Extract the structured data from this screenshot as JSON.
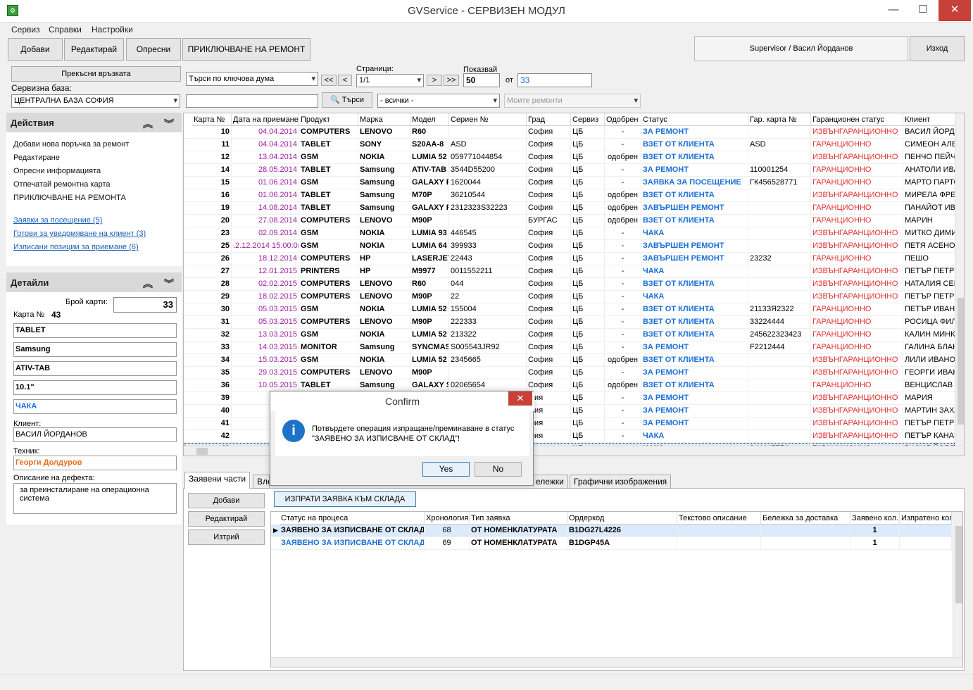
{
  "window": {
    "title": "GVService - СЕРВИЗЕН МОДУЛ",
    "icon": "app-icon",
    "min": "—",
    "max": "☐",
    "close": "✕"
  },
  "menu": [
    "Сервиз",
    "Справки",
    "Настройки"
  ],
  "toolbar": {
    "add": "Добави",
    "edit": "Редактирай",
    "refresh": "Опресни",
    "finish": "ПРИКЛЮЧВАНЕ НА РЕМОНТ",
    "user": "Supervisor / Васил Йорданов",
    "exit": "Изход"
  },
  "conn": {
    "disconnect": "Прекъсни връзката",
    "db_label": "Сервизна база:",
    "db_value": "ЦЕНТРАЛНА БАЗА СОФИЯ"
  },
  "search": {
    "mode": "Търси по ключова дума",
    "query": "",
    "button": "Търси",
    "filter": "- всички -",
    "my_repairs": "Моите ремонти"
  },
  "paging": {
    "label": "Страници:",
    "page": "1/1",
    "first": "<<",
    "prev": "<",
    "next": ">",
    "last": ">>",
    "show_label": "Показвай",
    "show_value": "50",
    "of_label": "от",
    "total": "33"
  },
  "actions": {
    "title": "Действия",
    "items": [
      "Добави нова поръчка за ремонт",
      "Редактиране",
      "Опресни информацията",
      "Отпечатай ремонтна карта",
      "ПРИКЛЮЧВАНЕ НА РЕМОНТА"
    ],
    "links": [
      "Заявки за посещение (5)",
      "Готови за уведомяване на клиент (3)",
      "Изписани позиции за приемане (6)"
    ]
  },
  "details": {
    "title": "Детайли",
    "count_label": "Брой карти:",
    "count": "33",
    "card_label": "Карта №",
    "card": "43",
    "product": "TABLET",
    "brand": "Samsung",
    "model": "ATIV-TAB",
    "size": "10.1\"",
    "status": "ЧАКА",
    "client_label": "Клиент:",
    "client": "ВАСИЛ ЙОРДАНОВ",
    "tech_label": "Техник:",
    "tech": "Георги Долдуров",
    "defect_label": "Описание на дефекта:",
    "defect": "за преинсталиране на операционна система"
  },
  "grid": {
    "columns": [
      "Карта №",
      "Дата на приемане",
      "Продукт",
      "Марка",
      "Модел",
      "Сериен №",
      "Град",
      "Сервиз",
      "Одобрен",
      "Статус",
      "Гар. карта №",
      "Гаранционен статус",
      "Клиент"
    ],
    "rows": [
      [
        "10",
        "04.04.2014",
        "COMPUTERS",
        "LENOVO",
        "R60",
        "",
        "София",
        "ЦБ",
        "-",
        "ЗА РЕМОНТ",
        "",
        "ИЗВЪНГАРАНЦИОННО",
        "ВАСИЛ ЙОРДА"
      ],
      [
        "11",
        "04.04.2014",
        "TABLET",
        "SONY",
        "S20AA-8",
        "ASD",
        "София",
        "ЦБ",
        "-",
        "ВЗЕТ ОТ КЛИЕНТА",
        "ASD",
        "ГАРАНЦИОННО",
        "СИМЕОН АЛЕК"
      ],
      [
        "12",
        "13.04.2014",
        "GSM",
        "NOKIA",
        "LUMIA 52",
        "059771044854",
        "София",
        "ЦБ",
        "одобрен",
        "ВЗЕТ ОТ КЛИЕНТА",
        "",
        "ИЗВЪНГАРАНЦИОННО",
        "ПЕНЧО ПЕЙЧЕ"
      ],
      [
        "14",
        "28.05.2014",
        "TABLET",
        "Samsung",
        "ATIV-TAB",
        "3544D55200",
        "София",
        "ЦБ",
        "-",
        "ЗА РЕМОНТ",
        "110001254",
        "ГАРАНЦИОННО",
        "АНАТОЛИ ИВА"
      ],
      [
        "15",
        "01.06.2014",
        "GSM",
        "Samsung",
        "GALAXY F",
        "1620044",
        "София",
        "ЦБ",
        "-",
        "ЗАЯВКА ЗА ПОСЕЩЕНИЕ",
        "ГК456528771",
        "ГАРАНЦИОННО",
        "МАРТО ПАРТО"
      ],
      [
        "16",
        "01.06.2014",
        "TABLET",
        "Samsung",
        "M70P",
        "36210544",
        "София",
        "ЦБ",
        "одобрен",
        "ВЗЕТ ОТ КЛИЕНТА",
        "",
        "ИЗВЪНГАРАНЦИОННО",
        "МИРЕЛА ФРЕН"
      ],
      [
        "19",
        "14.08.2014",
        "TABLET",
        "Samsung",
        "GALAXY F",
        "2312323S32223",
        "София",
        "ЦБ",
        "одобрен",
        "ЗАВЪРШЕН РЕМОНТ",
        "",
        "ГАРАНЦИОННО",
        "ПАНАЙОТ ИВА"
      ],
      [
        "20",
        "27.08.2014",
        "COMPUTERS",
        "LENOVO",
        "M90P",
        "",
        "БУРГАС",
        "ЦБ",
        "одобрен",
        "ВЗЕТ ОТ КЛИЕНТА",
        "",
        "ГАРАНЦИОННО",
        "МАРИН"
      ],
      [
        "23",
        "02.09.2014",
        "GSM",
        "NOKIA",
        "LUMIA 93",
        "446545",
        "София",
        "ЦБ",
        "-",
        "ЧАКА",
        "",
        "ИЗВЪНГАРАНЦИОННО",
        "МИТКО ДИМИ"
      ],
      [
        "25",
        ".2.12.2014 15:00:0(",
        "GSM",
        "NOKIA",
        "LUMIA 64",
        "399933",
        "София",
        "ЦБ",
        "-",
        "ЗАВЪРШЕН РЕМОНТ",
        "",
        "ИЗВЪНГАРАНЦИОННО",
        "ПЕТЯ АСЕНОВ"
      ],
      [
        "26",
        "18.12.2014",
        "COMPUTERS",
        "HP",
        "LASERJET",
        "22443",
        "София",
        "ЦБ",
        "-",
        "ЗАВЪРШЕН РЕМОНТ",
        "23232",
        "ГАРАНЦИОННО",
        "ПЕШО"
      ],
      [
        "27",
        "12.01.2015",
        "PRINTERS",
        "HP",
        "M9977",
        "0011552211",
        "София",
        "ЦБ",
        "-",
        "ЧАКА",
        "",
        "ИЗВЪНГАРАНЦИОННО",
        "ПЕТЪР ПЕТРУН"
      ],
      [
        "28",
        "02.02.2015",
        "COMPUTERS",
        "LENOVO",
        "R60",
        "044",
        "София",
        "ЦБ",
        "-",
        "ВЗЕТ ОТ КЛИЕНТА",
        "",
        "ИЗВЪНГАРАНЦИОННО",
        "НАТАЛИЯ СЕИ"
      ],
      [
        "29",
        "18.02.2015",
        "COMPUTERS",
        "LENOVO",
        "M90P",
        "22",
        "София",
        "ЦБ",
        "-",
        "ЧАКА",
        "",
        "ИЗВЪНГАРАНЦИОННО",
        "ПЕТЪР ПЕТРУН"
      ],
      [
        "30",
        "05.03.2015",
        "GSM",
        "NOKIA",
        "LUMIA 52",
        "155004",
        "София",
        "ЦБ",
        "-",
        "ВЗЕТ ОТ КЛИЕНТА",
        "2113ЗЯ2322",
        "ГАРАНЦИОННО",
        "ПЕТЪР ИВАНО"
      ],
      [
        "31",
        "05.03.2015",
        "COMPUTERS",
        "LENOVO",
        "M90P",
        "222333",
        "София",
        "ЦБ",
        "-",
        "ВЗЕТ ОТ КЛИЕНТА",
        "33224444",
        "ГАРАНЦИОННО",
        "РОСИЦА ФИЛИ"
      ],
      [
        "32",
        "13.03.2015",
        "GSM",
        "NOKIA",
        "LUMIA 52",
        "213322",
        "София",
        "ЦБ",
        "-",
        "ВЗЕТ ОТ КЛИЕНТА",
        "245622323423",
        "ГАРАНЦИОННО",
        "КАЛИН МИНКИ"
      ],
      [
        "33",
        "14.03.2015",
        "MONITOR",
        "Samsung",
        "SYNCMAS",
        "S005543JR92",
        "София",
        "ЦБ",
        "-",
        "ЗА РЕМОНТ",
        "F2212444",
        "ГАРАНЦИОННО",
        "ГАЛИНА БЛАН"
      ],
      [
        "34",
        "15.03.2015",
        "GSM",
        "NOKIA",
        "LUMIA 52",
        "2345665",
        "София",
        "ЦБ",
        "одобрен",
        "ВЗЕТ ОТ КЛИЕНТА",
        "",
        "ИЗВЪНГАРАНЦИОННО",
        "ЛИЛИ ИВАНОВ"
      ],
      [
        "35",
        "29.03.2015",
        "COMPUTERS",
        "LENOVO",
        "M90P",
        "",
        "София",
        "ЦБ",
        "-",
        "ЗА РЕМОНТ",
        "",
        "ИЗВЪНГАРАНЦИОННО",
        "ГЕОРГИ ИВАНС"
      ],
      [
        "36",
        "10.05.2015",
        "TABLET",
        "Samsung",
        "GALAXY S",
        "02065654",
        "София",
        "ЦБ",
        "одобрен",
        "ВЗЕТ ОТ КЛИЕНТА",
        "",
        "ГАРАНЦИОННО",
        "ВЕНЦИСЛАВ С"
      ],
      [
        "39",
        "19.05.2",
        "",
        "",
        "",
        "",
        "фия",
        "ЦБ",
        "-",
        "ЗА РЕМОНТ",
        "",
        "ИЗВЪНГАРАНЦИОННО",
        "МАРИЯ"
      ],
      [
        "40",
        "13.08.2",
        "",
        "",
        "",
        "",
        "фия",
        "ЦБ",
        "-",
        "ЗА РЕМОНТ",
        "",
        "ИЗВЪНГАРАНЦИОННО",
        "МАРТИН ЗАХАI"
      ],
      [
        "41",
        "13.08.2",
        "",
        "",
        "",
        "",
        "фия",
        "ЦБ",
        "-",
        "ЗА РЕМОНТ",
        "",
        "ИЗВЪНГАРАНЦИОННО",
        "ПЕТЪР ПЕТРУН"
      ],
      [
        "42",
        "15.12.2",
        "",
        "",
        "",
        "",
        "фия",
        "ЦБ",
        "-",
        "ЧАКА",
        "",
        "ИЗВЪНГАРАНЦИОННО",
        "ПЕТЪР КАНАЗ"
      ],
      [
        "43",
        "21.02.2",
        "",
        "",
        "",
        "",
        "фия",
        "ЦБ",
        "-",
        "ЧАКА",
        "044447774",
        "ГАРАНЦИОННО",
        "ВАСИЛ ЙОРДА"
      ]
    ]
  },
  "tabs": [
    "Заявени части",
    "Вло",
    "ележки",
    "Графични изображения"
  ],
  "parts": {
    "send_button": "ИЗПРАТИ ЗАЯВКА КЪМ СКЛАДА",
    "add": "Добави",
    "edit": "Редактирай",
    "delete": "Изтрий",
    "columns": [
      "Статус на процеса",
      "Хронология",
      "Тип заявка",
      "Ордеркод",
      "Текстово описание",
      "Бележка за доставка",
      "Заявено кол.",
      "Изпратено кол"
    ],
    "rows": [
      [
        "ЗАЯВЕНО ЗА ИЗПИСВАНЕ ОТ СКЛАД",
        "68",
        "ОТ НОМЕНКЛАТУРАТА",
        "B1DG27L4226",
        "",
        "",
        "1",
        ""
      ],
      [
        "ЗАЯВЕНО ЗА ИЗПИСВАНЕ ОТ СКЛАД",
        "69",
        "ОТ НОМЕНКЛАТУРАТА",
        "B1DGP45A",
        "",
        "",
        "1",
        ""
      ]
    ]
  },
  "dialog": {
    "title": "Confirm",
    "message": "Потвърдете операция изпращане/преминаване в статус \"ЗАЯВЕНО ЗА ИЗПИСВАНЕ ОТ СКЛАД\"!",
    "yes": "Yes",
    "no": "No",
    "icon": "info-icon"
  },
  "colors": {
    "status_blue": "#1a6ed8",
    "warranty_red": "#e03030",
    "date_purple": "#a020a0",
    "tech_orange": "#e07020"
  }
}
